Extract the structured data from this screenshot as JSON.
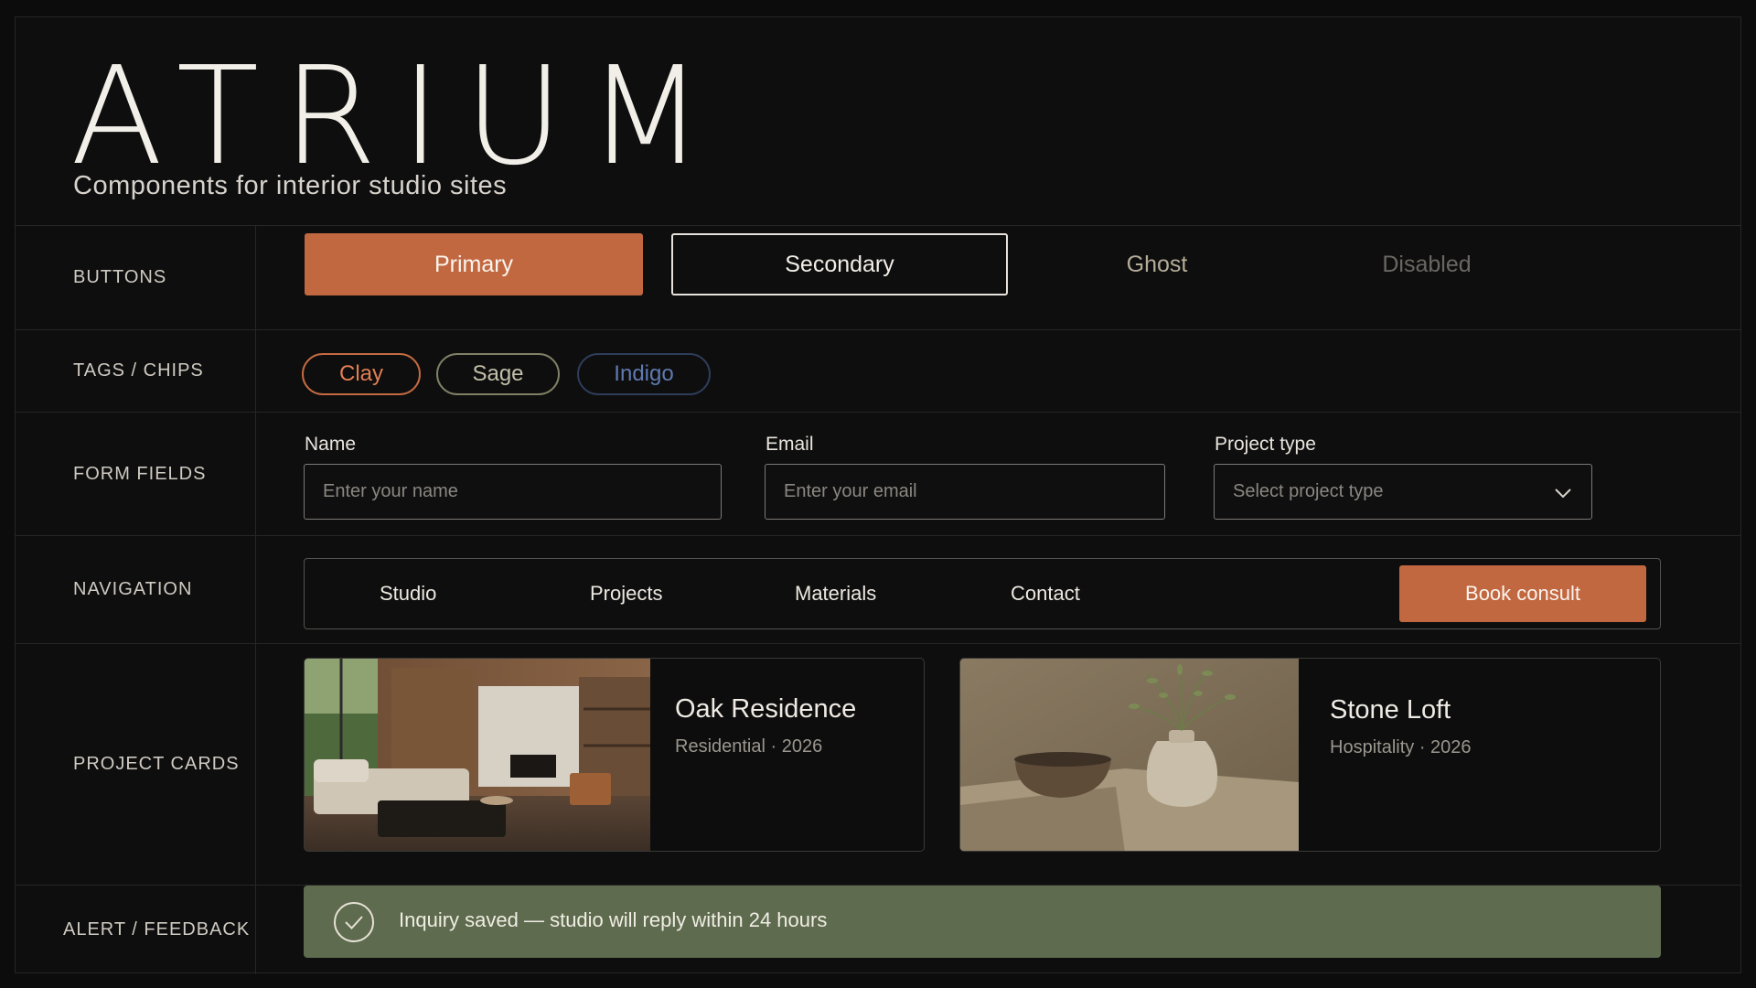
{
  "brand": {
    "name": "ATRIUM",
    "tagline": "Components for interior studio sites"
  },
  "sections": {
    "buttons": "BUTTONS",
    "tags": "TAGS / CHIPS",
    "form": "FORM FIELDS",
    "navigation": "NAVIGATION",
    "cards": "PROJECT CARDS",
    "alert": "ALERT / FEEDBACK"
  },
  "buttons": {
    "primary": "Primary",
    "secondary": "Secondary",
    "ghost": "Ghost",
    "disabled": "Disabled"
  },
  "chips": [
    "Clay",
    "Sage",
    "Indigo"
  ],
  "form": {
    "name_label": "Name",
    "name_placeholder": "Enter your name",
    "email_label": "Email",
    "email_placeholder": "Enter your email",
    "project_label": "Project type",
    "project_placeholder": "Select project type"
  },
  "nav": {
    "items": [
      "Studio",
      "Projects",
      "Materials",
      "Contact"
    ],
    "cta": "Book consult"
  },
  "cards": [
    {
      "title": "Oak Residence",
      "meta": "Residential · 2026"
    },
    {
      "title": "Stone Loft",
      "meta": "Hospitality · 2026"
    }
  ],
  "alert": {
    "message": "Inquiry saved — studio will reply within 24 hours"
  },
  "colors": {
    "clay": "#c26841",
    "sage": "#7f8066",
    "indigo": "#5f7ab0",
    "alert_bg": "#5e6b4e",
    "background": "#0c0c0c"
  }
}
